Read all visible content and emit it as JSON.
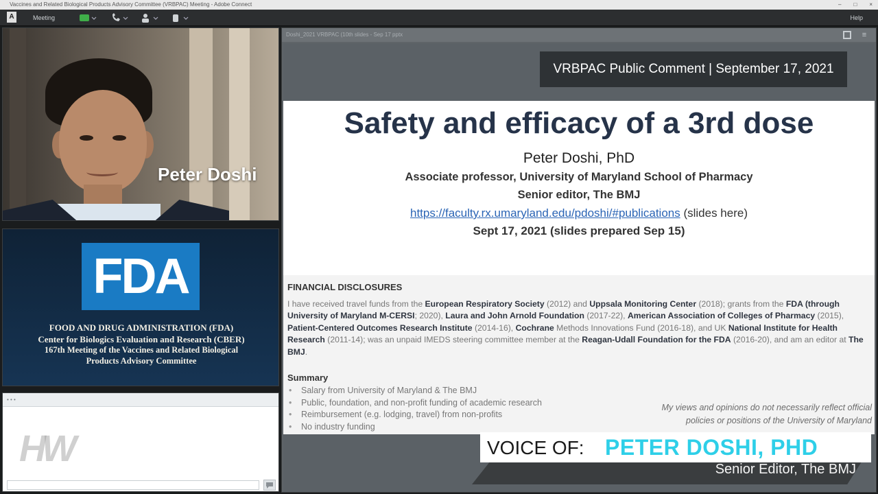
{
  "window": {
    "title": "Vaccines and Related Biological Products Advisory Committee (VRBPAC) Meeting - Adobe Connect",
    "controls": [
      "–",
      "□",
      "×"
    ]
  },
  "toolbar": {
    "logo": "A",
    "meeting_label": "Meeting",
    "help_label": "Help"
  },
  "presenter": {
    "name": "Peter Doshi"
  },
  "fda": {
    "logo_text": "FDA",
    "lines": [
      "FOOD AND DRUG ADMINISTRATION (FDA)",
      "Center for Biologics Evaluation and Research (CBER)",
      "167th Meeting of the Vaccines and Related Biological",
      "Products Advisory Committee"
    ]
  },
  "chat": {
    "header": "• • •",
    "watermark": "HW"
  },
  "share": {
    "pod_title": "Doshi_2021 VRBPAC (10th slides - Sep 17 pptx"
  },
  "slide": {
    "tag": "VRBPAC Public Comment | September 17, 2021",
    "title": "Safety and efficacy of a 3rd dose",
    "author": "Peter Doshi, PhD",
    "affiliation_1": "Associate professor, University of Maryland School of Pharmacy",
    "affiliation_2": "Senior editor, The BMJ",
    "link": "https://faculty.rx.umaryland.edu/pdoshi/#publications",
    "link_suffix": " (slides here)",
    "date": "Sept 17, 2021 (slides prepared Sep 15)",
    "disclosures_heading": "FINANCIAL DISCLOSURES",
    "disclosures": [
      {
        "t": "I have received travel funds from the ",
        "b": false
      },
      {
        "t": "European Respiratory Society",
        "b": true
      },
      {
        "t": " (2012) and ",
        "b": false
      },
      {
        "t": "Uppsala Monitoring Center",
        "b": true
      },
      {
        "t": " (2018); grants from the ",
        "b": false
      },
      {
        "t": "FDA (through University of Maryland M-CERSI",
        "b": true
      },
      {
        "t": "; 2020), ",
        "b": false
      },
      {
        "t": "Laura and John Arnold Foundation",
        "b": true
      },
      {
        "t": " (2017-22), ",
        "b": false
      },
      {
        "t": "American Association of Colleges of Pharmacy",
        "b": true
      },
      {
        "t": " (2015), ",
        "b": false
      },
      {
        "t": "Patient-Centered Outcomes Research Institute",
        "b": true
      },
      {
        "t": " (2014-16), ",
        "b": false
      },
      {
        "t": "Cochrane",
        "b": true
      },
      {
        "t": " Methods Innovations Fund (2016-18), and UK ",
        "b": false
      },
      {
        "t": "National Institute for Health Research",
        "b": true
      },
      {
        "t": " (2011-14); was an unpaid IMEDS steering committee member at the ",
        "b": false
      },
      {
        "t": "Reagan-Udall Foundation for the FDA",
        "b": true
      },
      {
        "t": " (2016-20), and am an editor at ",
        "b": false
      },
      {
        "t": "The BMJ",
        "b": true
      },
      {
        "t": ".",
        "b": false
      }
    ],
    "summary_heading": "Summary",
    "summary_items": [
      "Salary from University of Maryland & The BMJ",
      "Public, foundation, and non-profit funding of academic research",
      "Reimbursement (e.g. lodging, travel) from non-profits",
      "No industry funding"
    ],
    "disclaimer_1": "My views and opinions do not necessarily reflect official",
    "disclaimer_2": "policies or positions of the University of Maryland"
  },
  "lower_third": {
    "label": "VOICE OF:",
    "name": "PETER DOSHI, PHD",
    "role": "Senior Editor, The BMJ",
    "accent_color": "#2ecfe8"
  }
}
